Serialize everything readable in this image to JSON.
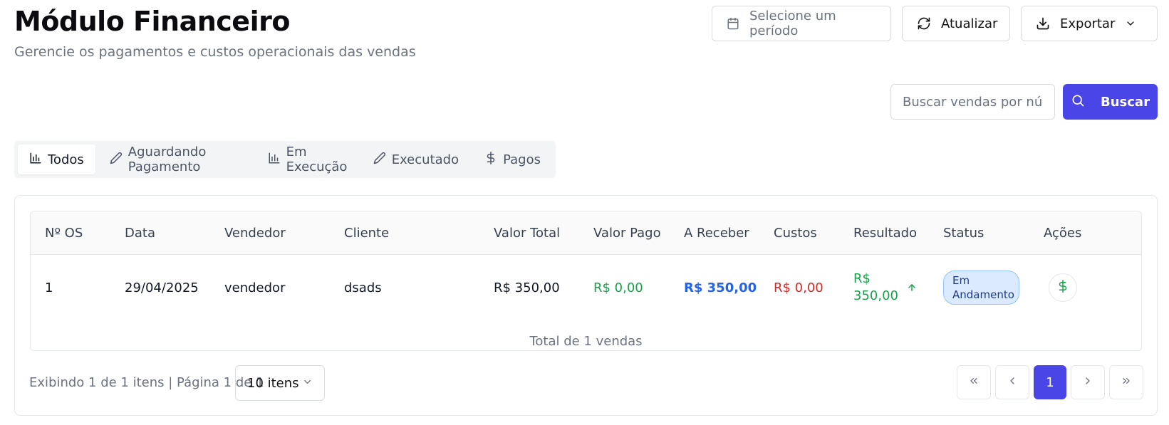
{
  "header": {
    "title": "Módulo Financeiro",
    "subtitle": "Gerencie os pagamentos e custos operacionais das vendas"
  },
  "toolbar": {
    "period_placeholder": "Selecione um período",
    "refresh_label": "Atualizar",
    "export_label": "Exportar"
  },
  "search": {
    "placeholder": "Buscar vendas por número",
    "button_label": "Buscar"
  },
  "tabs": [
    {
      "label": "Todos",
      "icon": "bar-chart-icon",
      "active": true
    },
    {
      "label": "Aguardando Pagamento",
      "icon": "pencil-icon",
      "active": false
    },
    {
      "label": "Em Execução",
      "icon": "bar-chart-icon",
      "active": false
    },
    {
      "label": "Executado",
      "icon": "pencil-icon",
      "active": false
    },
    {
      "label": "Pagos",
      "icon": "dollar-icon",
      "active": false
    }
  ],
  "table": {
    "columns": [
      "Nº OS",
      "Data",
      "Vendedor",
      "Cliente",
      "Valor Total",
      "Valor Pago",
      "A Receber",
      "Custos",
      "Resultado",
      "Status",
      "Ações"
    ],
    "rows": [
      {
        "os": "1",
        "date": "29/04/2025",
        "seller": "vendedor",
        "client": "dsads",
        "total": "R$ 350,00",
        "paid": "R$ 0,00",
        "receivable": "R$ 350,00",
        "costs": "R$ 0,00",
        "result": "R$ 350,00",
        "status": "Em Andamento"
      }
    ],
    "total_label": "Total de 1 vendas"
  },
  "pagination": {
    "info": "Exibindo 1 de 1 itens | Página 1 de 1",
    "page_size": "10 itens",
    "current_page": "1"
  },
  "colors": {
    "accent": "#4945e6",
    "positive": "#16a34a",
    "receivable": "#2563eb",
    "negative": "#dc2626"
  }
}
